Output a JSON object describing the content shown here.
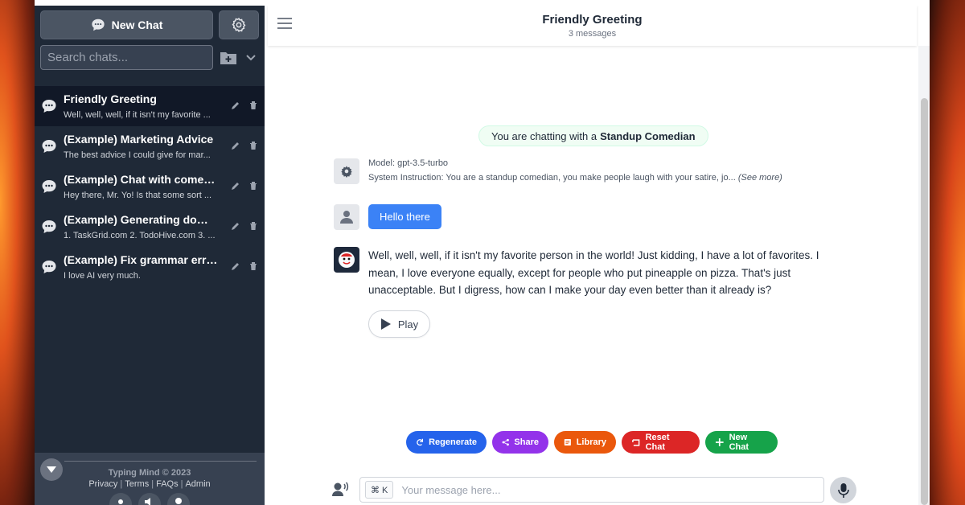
{
  "sidebar": {
    "new_chat_label": "New Chat",
    "search_placeholder": "Search chats...",
    "chats": [
      {
        "title": "Friendly Greeting",
        "preview": "Well, well, well, if it isn't my favorite ...",
        "active": true
      },
      {
        "title": "(Example) Marketing Advice",
        "preview": "The best advice I could give for mar...",
        "active": false
      },
      {
        "title": "(Example) Chat with comedian",
        "preview": "Hey there, Mr. Yo! Is that some sort ...",
        "active": false
      },
      {
        "title": "(Example) Generating domain ...",
        "preview": "1. TaskGrid.com 2. TodoHive.com 3. ...",
        "active": false
      },
      {
        "title": "(Example) Fix grammar errors",
        "preview": "I love AI very much.",
        "active": false
      }
    ],
    "footer": {
      "copyright": "Typing Mind © 2023",
      "links": [
        "Privacy",
        "Terms",
        "FAQs",
        "Admin"
      ],
      "separator": "|"
    }
  },
  "header": {
    "title": "Friendly Greeting",
    "subtitle": "3 messages"
  },
  "conversation": {
    "persona_prefix": "You are chatting with a",
    "persona_name": "Standup Comedian",
    "system": {
      "model": "Model: gpt-3.5-turbo",
      "instruction": "System Instruction: You are a standup comedian, you make people laugh with your satire, jo...",
      "see_more": "(See more)"
    },
    "user_message": "Hello there",
    "bot_message": "Well, well, well, if it isn't my favorite person in the world! Just kidding, I have a lot of favorites. I mean, I love everyone equally, except for people who put pineapple on pizza. That's just unacceptable. But I digress, how can I make your day even better than it already is?",
    "play_label": "Play"
  },
  "actions": {
    "regenerate": "Regenerate",
    "share": "Share",
    "library": "Library",
    "reset": "Reset Chat",
    "new_chat": "New Chat"
  },
  "composer": {
    "shortcut": "⌘ K",
    "placeholder": "Your message here..."
  },
  "colors": {
    "sidebar_bg": "#1f2937",
    "accent_blue": "#3b82f6",
    "regenerate": "#2563eb",
    "share": "#9333ea",
    "library": "#ea580c",
    "reset": "#dc2626",
    "new_chat": "#16a34a"
  }
}
